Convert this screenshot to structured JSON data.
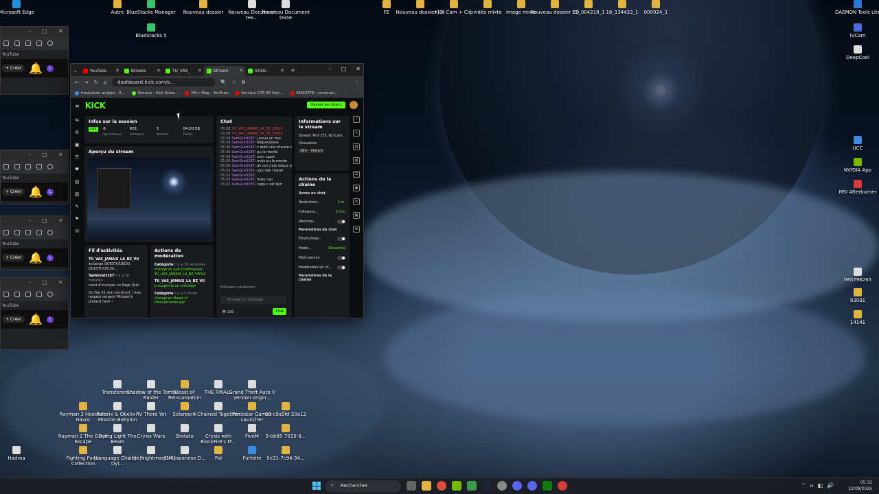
{
  "desktop": {
    "top_icons": [
      {
        "label": "Microsoft Edge",
        "color": "#1f8fe0"
      },
      {
        "label": "Autre",
        "color": "#e3b341"
      },
      {
        "label": "BlueStacks Manager",
        "color": "#35c46a"
      },
      {
        "label": "BlueStacks 5",
        "color": "#35c46a"
      },
      {
        "label": "Nouveau dossier",
        "color": "#e3b341"
      },
      {
        "label": "Nouveau Document tex...",
        "color": "#dddddd"
      },
      {
        "label": "Nouveau Document texte",
        "color": "#dddddd"
      },
      {
        "label": "FE",
        "color": "#e3b341"
      },
      {
        "label": "Nouveau dossier (2)",
        "color": "#e3b341"
      },
      {
        "label": "Kick Cam + Clip",
        "color": "#e3b341"
      },
      {
        "label": "vidéo mixte",
        "color": "#e3b341"
      },
      {
        "label": "image mixte",
        "color": "#e3b341"
      },
      {
        "label": "Nouveau dossier (3)",
        "color": "#e3b341"
      },
      {
        "label": "22_004218_1",
        "color": "#e3b341"
      },
      {
        "label": "18_134433_1",
        "color": "#e3b341"
      },
      {
        "label": "000924_1",
        "color": "#e3b341"
      },
      {
        "label": "DAEMON Tools Lite",
        "color": "#2a7bd6"
      }
    ],
    "right_icons": [
      {
        "label": "iVCam",
        "color": "#4a6bd6"
      },
      {
        "label": "DeepCool",
        "color": "#dddddd"
      },
      {
        "label": "UCC",
        "color": "#3a8de0"
      },
      {
        "label": "NVIDIA App",
        "color": "#76b900"
      },
      {
        "label": "MSI Afterburner",
        "color": "#d63a3a"
      },
      {
        "label": "IMG796265",
        "color": "#dddddd"
      },
      {
        "label": "83081",
        "color": "#e3b341"
      },
      {
        "label": "14141",
        "color": "#e3b341"
      }
    ],
    "bottom_icons": [
      {
        "label": "Transference",
        "color": "#dddddd"
      },
      {
        "label": "Shadow of the Tomb Raider",
        "color": "#dddddd"
      },
      {
        "label": "Beast of Reincarnation",
        "color": "#e3b341"
      },
      {
        "label": "THE FINALS",
        "color": "#dddddd"
      },
      {
        "label": "Grand Theft Auto V Version origin...",
        "color": "#dddddd"
      },
      {
        "label": "Rayman 3 Hoodlum Havoc",
        "color": "#e3b341"
      },
      {
        "label": "Asterix & Obelix - Mission Babylon",
        "color": "#dddddd"
      },
      {
        "label": "RV There Yet",
        "color": "#dddddd"
      },
      {
        "label": "Solarpunk",
        "color": "#e3b341"
      },
      {
        "label": "Chained Together",
        "color": "#dddddd"
      },
      {
        "label": "Rockstar Games Launcher",
        "color": "#e3b341"
      },
      {
        "label": "00-c9a5fd-20a12",
        "color": "#e3b341"
      },
      {
        "label": "Rayman 2 The Great Escape",
        "color": "#e3b341"
      },
      {
        "label": "Dying Light The Beast",
        "color": "#dddddd"
      },
      {
        "label": "Crysis Wars",
        "color": "#dddddd"
      },
      {
        "label": "Brotato",
        "color": "#dddddd"
      },
      {
        "label": "Crysis with BlackFire's M...",
        "color": "#dddddd"
      },
      {
        "label": "FiveM",
        "color": "#dddddd"
      },
      {
        "label": "9-bb85-7035-8...",
        "color": "#e3b341"
      },
      {
        "label": "Fighting Force Collection",
        "color": "#e3b341"
      },
      {
        "label": "[Language Change] Dyi...",
        "color": "#dddddd"
      },
      {
        "label": "Little Nightmares III",
        "color": "#dddddd"
      },
      {
        "label": "JDM.Japanese.D...",
        "color": "#dddddd"
      },
      {
        "label": "Pal",
        "color": "#e3b341"
      },
      {
        "label": "Fortnite",
        "color": "#3a8de0"
      },
      {
        "label": "0e31-7c94-34...",
        "color": "#e3b341"
      },
      {
        "label": "Hadroa",
        "color": "#dddddd"
      }
    ]
  },
  "bg_windows": {
    "youtube": "YouTube",
    "create": "+ Créer",
    "avatar": "L"
  },
  "browser": {
    "tabs": [
      {
        "label": "YouTube",
        "color": "#ff0000"
      },
      {
        "label": "Browse",
        "color": "#53fc18"
      },
      {
        "label": "TU_VAS_",
        "color": "#53fc18"
      },
      {
        "label": "Stream",
        "color": "#53fc18"
      },
      {
        "label": "VODs - ",
        "color": "#53fc18"
      }
    ],
    "url": "dashboard.kick.com/s...",
    "bookmarks": [
      {
        "label": "traduction anglais - R...",
        "color": "#4285f4"
      },
      {
        "label": "Browse - Kick Strea...",
        "color": "#53fc18"
      },
      {
        "label": "M6+ Mag - YouTube",
        "color": "#ff0000"
      },
      {
        "label": "Serveur GTA RP fran...",
        "color": "#ff0000"
      },
      {
        "label": "ENQUÊTE : commen...",
        "color": "#ff0000"
      }
    ]
  },
  "kick": {
    "logo": "KICK",
    "go_live": "Passer en direct",
    "session": {
      "title": "Infos sur la session",
      "live_badge": "LIVE",
      "stats": [
        {
          "value": "6",
          "label": "Spectateurs"
        },
        {
          "value": "631",
          "label": "Followers"
        },
        {
          "value": "3",
          "label": "Nombre"
        },
        {
          "value": "04:20:58",
          "label": "Temps"
        }
      ]
    },
    "preview_title": "Aperçu du stream",
    "activity": {
      "title": "Fil d'activités",
      "items": [
        {
          "user": "TU_VAS_JAMAIS_LA_BZ_VII",
          "text": "échange QUESTIVUEUIU QUESTIVUEUIU..."
        },
        {
          "user": "SamGratt187",
          "time": "il y a 10 minutes",
          "text": "vient d'envoyer un Rage Quit"
        },
        {
          "user": "",
          "text": "Go Top 01 non construct ! mes respect sergent Mickael à plutard l'ami !"
        }
      ]
    },
    "moderation": {
      "title": "Actions de modération",
      "items": [
        {
          "label": "Catégorie",
          "time": "il y a 16 secondes",
          "text": "changé en Just Chatting par TU_VAS_JAMAIS_LA_BZ_VIEUX"
        },
        {
          "label": "TU_VAS_JAMAIS_LA_BZ_VII",
          "time": "",
          "text": "a supprimé un message"
        },
        {
          "label": "Catégorie",
          "time": "il y a 1 heure",
          "text": "changé en Beast of Reincarnation par"
        }
      ]
    },
    "chat": {
      "title": "Chat",
      "messages": [
        {
          "t": "05:28",
          "u": "TU_VAS_JAMAIS_LA_BZ_VIEUX",
          "m": "",
          "red": true
        },
        {
          "t": "05:28",
          "u": "TU_VAS_JAMAIS_LA_BZ_VIEUX",
          "m": "",
          "red": true
        },
        {
          "t": "05:29",
          "u": "SamGratt187",
          "m": ": j essai un truc"
        },
        {
          "t": "05:30",
          "u": "SamGratt187",
          "m": ": dégueulasse"
        },
        {
          "t": "05:30",
          "u": "SamGratt187",
          "m": ": c etait une chauve souris"
        },
        {
          "t": "05:30",
          "u": "SamGratt187",
          "m": ": pu la merde"
        },
        {
          "t": "05:30",
          "u": "SamGratt187",
          "m": ": mon spam"
        },
        {
          "t": "05:30",
          "u": "SamGratt187",
          "m": ": mais pu la merde"
        },
        {
          "t": "05:30",
          "u": "SamGratt187",
          "m": ": ah oui c'est mieux je pense"
        },
        {
          "t": "05:30",
          "u": "SamGratt187",
          "m": ": nan rien tinkiet"
        },
        {
          "t": "05:32",
          "u": "SamGratt187",
          "m": ":"
        },
        {
          "t": "05:32",
          "u": "SamGratt187",
          "m": ": mais nan"
        },
        {
          "t": "05:32",
          "u": "SamGratt187",
          "m": ": supp c est bon"
        }
      ],
      "followers_only": "Followers seulement",
      "placeholder": "Envoyer un message",
      "viewers": "190",
      "send": "Chat"
    },
    "info": {
      "title": "Informations sur le stream",
      "stream_title": "Stream Test 155. No Cam.",
      "category": "Discussion",
      "tags": [
        "18+",
        "French"
      ]
    },
    "channel": {
      "title": "Actions de la chaîne",
      "chat_access": "Accès au chat",
      "rows": [
        {
          "label": "Restriction...",
          "value": "2 m."
        },
        {
          "label": "Followers...",
          "value": "3 min"
        },
        {
          "label": "Abonnés...",
          "value": ""
        }
      ],
      "chat_settings": "Paramètres du chat",
      "rows2": [
        {
          "label": "Émoticônes...",
          "value": ""
        },
        {
          "label": "Mode...",
          "value": "Désactivé"
        },
        {
          "label": "Mots bannis",
          "value": ""
        },
        {
          "label": "Modération de ch...",
          "value": ""
        }
      ],
      "channel_settings": "Paramètres de la chaîne"
    }
  },
  "taskbar": {
    "search": "Rechercher",
    "time": "05:32",
    "date": "22/08/2026"
  }
}
